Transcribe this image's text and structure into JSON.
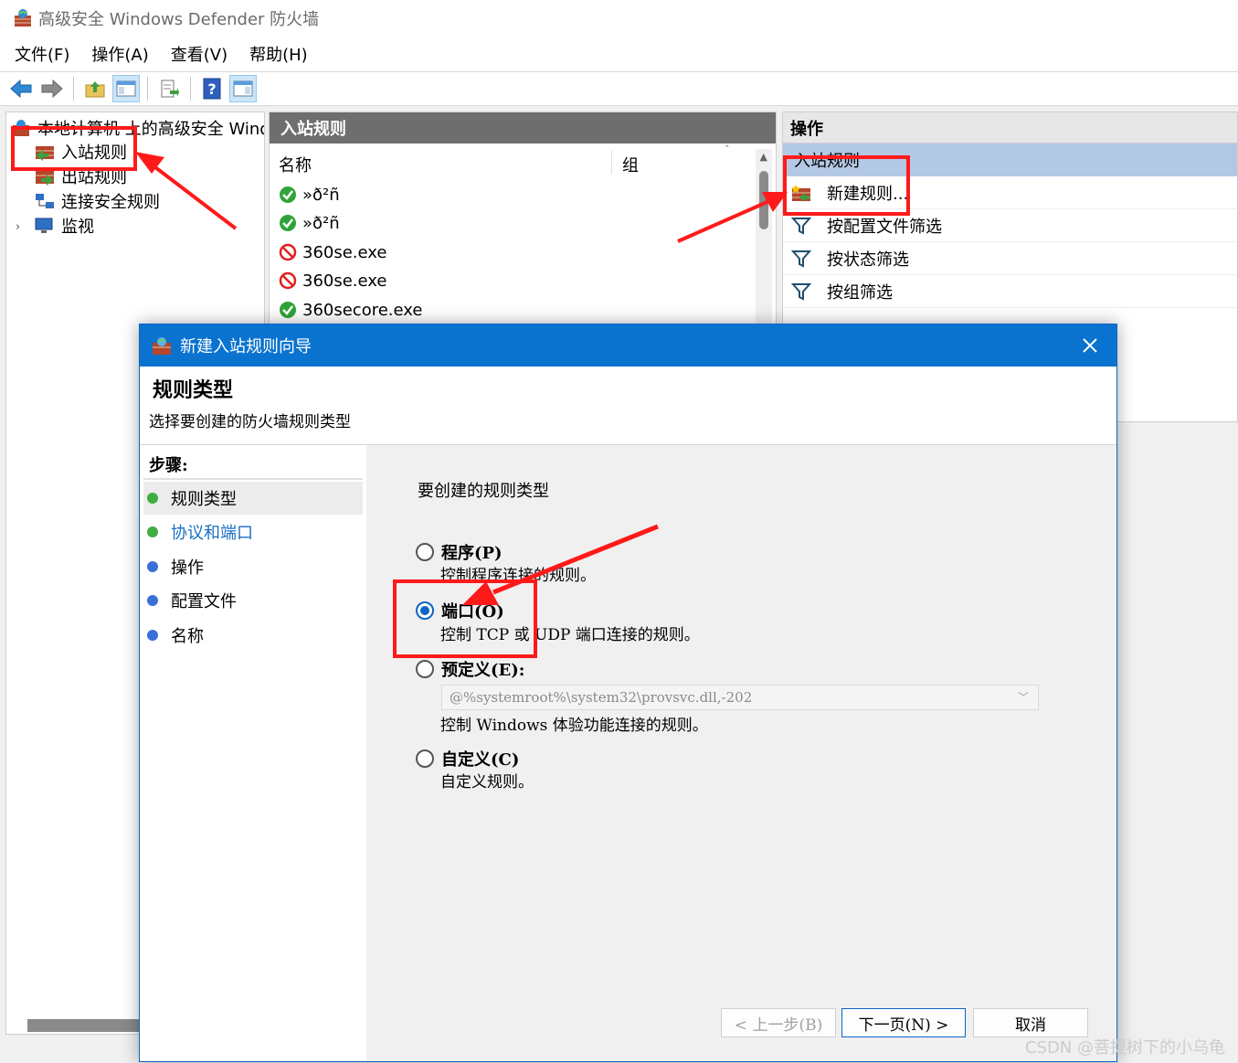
{
  "window": {
    "title": "高级安全 Windows Defender 防火墙"
  },
  "menu": [
    "文件(F)",
    "操作(A)",
    "查看(V)",
    "帮助(H)"
  ],
  "tree": {
    "root": "本地计算机 上的高级安全 Windows Defender 防火墙",
    "items": [
      "入站规则",
      "出站规则",
      "连接安全规则",
      "监视"
    ]
  },
  "middle": {
    "header": "入站规则",
    "columns": [
      "名称",
      "组"
    ],
    "rows": [
      {
        "status": "allow",
        "name": "»ð²ñ"
      },
      {
        "status": "allow",
        "name": "»ð²ñ"
      },
      {
        "status": "block",
        "name": "360se.exe"
      },
      {
        "status": "block",
        "name": "360se.exe"
      },
      {
        "status": "allow",
        "name": "360secore.exe"
      }
    ]
  },
  "actions": {
    "header": "操作",
    "section": "入站规则",
    "items": [
      "新建规则...",
      "按配置文件筛选",
      "按状态筛选",
      "按组筛选"
    ]
  },
  "dialog": {
    "title": "新建入站规则向导",
    "heading": "规则类型",
    "subheading": "选择要创建的防火墙规则类型",
    "steps_title": "步骤:",
    "steps": [
      "规则类型",
      "协议和端口",
      "操作",
      "配置文件",
      "名称"
    ],
    "question": "要创建的规则类型",
    "options": [
      {
        "label": "程序(P)",
        "desc": "控制程序连接的规则。",
        "selected": false
      },
      {
        "label": "端口(O)",
        "desc": "控制 TCP 或 UDP 端口连接的规则。",
        "selected": true
      },
      {
        "label": "预定义(E):",
        "desc": "控制 Windows 体验功能连接的规则。",
        "selected": false
      },
      {
        "label": "自定义(C)",
        "desc": "自定义规则。",
        "selected": false
      }
    ],
    "predefined_value": "@%systemroot%\\system32\\provsvc.dll,-202",
    "buttons": {
      "back": "< 上一步(B)",
      "next": "下一页(N) >",
      "cancel": "取消"
    }
  },
  "watermark": "CSDN @菩提树下的小乌龟",
  "colors": {
    "dialog_title": "#0a73cf",
    "annotation": "#ff1a1a",
    "selection": "#b3c8e4",
    "step_done": "#3fae3f",
    "step_todo": "#3a6fd8",
    "link": "#1a6fc4"
  }
}
